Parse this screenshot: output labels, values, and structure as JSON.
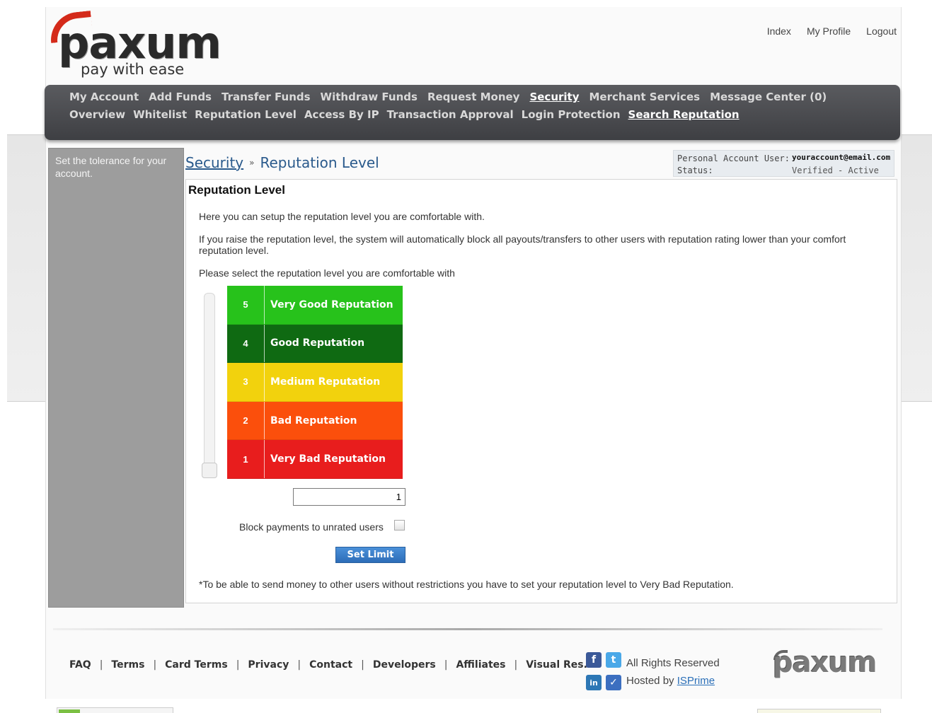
{
  "header": {
    "logo_text": "paxum",
    "tagline": "pay with ease",
    "top_links": [
      "Index",
      "My Profile",
      "Logout"
    ]
  },
  "nav": {
    "primary": [
      {
        "label": "My Account",
        "active": false
      },
      {
        "label": "Add Funds",
        "active": false
      },
      {
        "label": "Transfer Funds",
        "active": false
      },
      {
        "label": "Withdraw Funds",
        "active": false
      },
      {
        "label": "Request Money",
        "active": false
      },
      {
        "label": "Security",
        "active": true
      },
      {
        "label": "Merchant Services",
        "active": false
      },
      {
        "label": "Message Center (0)",
        "active": false
      }
    ],
    "secondary": [
      {
        "label": "Overview",
        "active": false
      },
      {
        "label": "Whitelist",
        "active": false
      },
      {
        "label": "Reputation Level",
        "active": false
      },
      {
        "label": "Access By IP",
        "active": false
      },
      {
        "label": "Transaction Approval",
        "active": false
      },
      {
        "label": "Login Protection",
        "active": false
      },
      {
        "label": "Search Reputation",
        "active": true
      }
    ]
  },
  "sidebar": {
    "text": "Set the tolerance for your account."
  },
  "breadcrumb": {
    "parent": "Security",
    "separator": "»",
    "current": "Reputation Level"
  },
  "account": {
    "user_label": "Personal Account User:",
    "user_value": "youraccount@email.com",
    "status_label": "Status:",
    "status_value": "Verified - Active"
  },
  "main": {
    "heading": "Reputation Level",
    "intro": "Here you can setup the reputation level you are comfortable with.",
    "raise_note": "If you raise the reputation level, the system will automatically block all payouts/transfers to other users with reputation rating lower than your comfort reputation level.",
    "select_prompt": "Please select the reputation level you are comfortable with",
    "levels": [
      {
        "num": "5",
        "label": "Very Good Reputation",
        "color": "#27c21b"
      },
      {
        "num": "4",
        "label": "Good Reputation",
        "color": "#0f6a12"
      },
      {
        "num": "3",
        "label": "Medium Reputation",
        "color": "#f2d20d"
      },
      {
        "num": "2",
        "label": "Bad Reputation",
        "color": "#fb4f0c"
      },
      {
        "num": "1",
        "label": "Very Bad Reputation",
        "color": "#e81d1d"
      }
    ],
    "selected_level": "1",
    "block_label": "Block payments to unrated users",
    "block_checked": false,
    "set_button": "Set Limit",
    "footnote": "*To be able to send money to other users without restrictions you have to set your reputation level to Very Bad Reputation."
  },
  "footer": {
    "links": [
      "FAQ",
      "Terms",
      "Card Terms",
      "Privacy",
      "Contact",
      "Developers",
      "Affiliates",
      "Visual Res."
    ],
    "rights": "All Rights Reserved",
    "hosted_prefix": "Hosted by",
    "hosted_link": "ISPrime",
    "logo_text": "paxum",
    "social_icons": [
      "facebook-icon",
      "twitter-icon",
      "linkedin-icon",
      "delicious-icon"
    ]
  }
}
